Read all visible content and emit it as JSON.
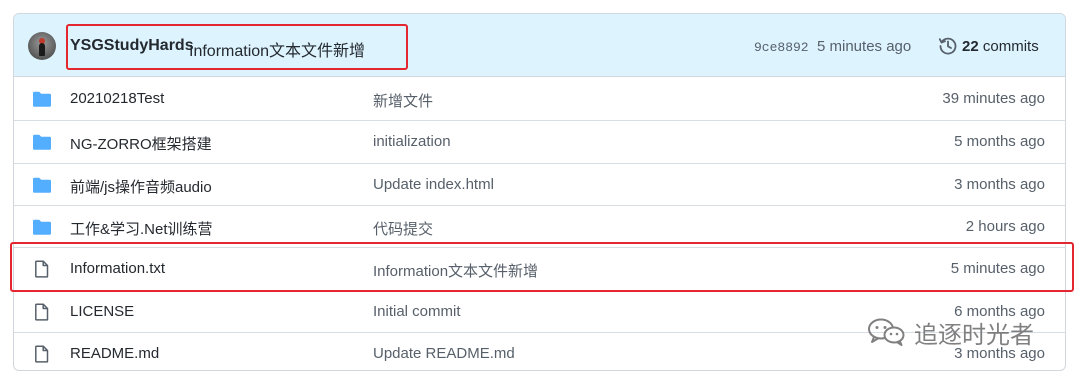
{
  "latest_commit": {
    "author": "YSGStudyHards",
    "message": "Information文本文件新增",
    "sha": "9ce8892",
    "time": "5 minutes ago",
    "commits_count": "22",
    "commits_label": "commits"
  },
  "files": [
    {
      "type": "folder",
      "name": "20210218Test",
      "message": "新增文件",
      "age": "39 minutes ago"
    },
    {
      "type": "folder",
      "name": "NG-ZORRO框架搭建",
      "message": "initialization",
      "age": "5 months ago"
    },
    {
      "type": "folder",
      "name": "前端/js操作音频audio",
      "message": "Update index.html",
      "age": "3 months ago"
    },
    {
      "type": "folder",
      "name": "工作&学习.Net训练营",
      "message": "代码提交",
      "age": "2 hours ago"
    },
    {
      "type": "file",
      "name": "Information.txt",
      "message": "Information文本文件新增",
      "age": "5 minutes ago"
    },
    {
      "type": "file",
      "name": "LICENSE",
      "message": "Initial commit",
      "age": "6 months ago"
    },
    {
      "type": "file",
      "name": "README.md",
      "message": "Update README.md",
      "age": "3 months ago"
    }
  ],
  "icons": {
    "folder": "folder-icon",
    "file": "file-icon",
    "history": "history-icon"
  },
  "colors": {
    "header_bg": "#ddf4ff",
    "folder": "#54aeff",
    "highlight": "#e3262f"
  },
  "watermark": {
    "text": "追逐时光者"
  }
}
